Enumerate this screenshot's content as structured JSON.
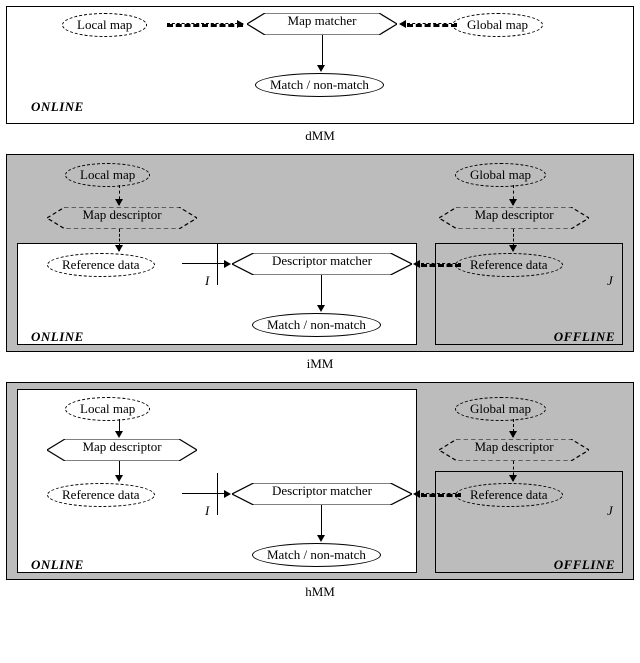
{
  "labels": {
    "local_map": "Local map",
    "global_map": "Global map",
    "map_matcher": "Map matcher",
    "match_nonmatch": "Match / non-match",
    "map_descriptor": "Map descriptor",
    "reference_data": "Reference data",
    "descriptor_matcher": "Descriptor matcher",
    "online": "ONLINE",
    "offline": "OFFLINE",
    "index_I": "I",
    "index_J": "J"
  },
  "captions": {
    "dMM": "dMM",
    "iMM": "iMM",
    "hMM": "hMM"
  },
  "chart_data": {
    "type": "flow-diagram",
    "panels": [
      {
        "id": "dMM",
        "background": "white",
        "tags": [
          "ONLINE"
        ],
        "nodes": [
          {
            "id": "local_map",
            "kind": "data",
            "label": "Local map"
          },
          {
            "id": "global_map",
            "kind": "data",
            "label": "Global map"
          },
          {
            "id": "map_matcher",
            "kind": "process",
            "label": "Map matcher"
          },
          {
            "id": "match",
            "kind": "data",
            "label": "Match / non-match"
          }
        ],
        "edges": [
          {
            "from": "local_map",
            "to": "map_matcher",
            "style": "dashed"
          },
          {
            "from": "global_map",
            "to": "map_matcher",
            "style": "dashed"
          },
          {
            "from": "map_matcher",
            "to": "match",
            "style": "solid"
          }
        ]
      },
      {
        "id": "iMM",
        "background": "grey",
        "tags": [
          "ONLINE",
          "OFFLINE"
        ],
        "nodes": [
          {
            "id": "local_map",
            "kind": "data",
            "label": "Local map",
            "region": "grey"
          },
          {
            "id": "global_map",
            "kind": "data",
            "label": "Global map",
            "region": "grey"
          },
          {
            "id": "desc_l",
            "kind": "process",
            "label": "Map descriptor",
            "region": "grey"
          },
          {
            "id": "desc_r",
            "kind": "process",
            "label": "Map descriptor",
            "region": "grey"
          },
          {
            "id": "ref_l",
            "kind": "data",
            "label": "Reference data",
            "index": "I",
            "region": "white"
          },
          {
            "id": "ref_r",
            "kind": "data",
            "label": "Reference data",
            "index": "J",
            "region": "grey-inner"
          },
          {
            "id": "dm",
            "kind": "process",
            "label": "Descriptor matcher",
            "region": "white"
          },
          {
            "id": "match",
            "kind": "data",
            "label": "Match / non-match",
            "region": "white"
          }
        ],
        "edges": [
          {
            "from": "local_map",
            "to": "desc_l",
            "style": "dashed"
          },
          {
            "from": "global_map",
            "to": "desc_r",
            "style": "dashed"
          },
          {
            "from": "desc_l",
            "to": "ref_l",
            "style": "dashed"
          },
          {
            "from": "desc_r",
            "to": "ref_r",
            "style": "dashed"
          },
          {
            "from": "ref_l",
            "to": "dm",
            "style": "solid"
          },
          {
            "from": "ref_r",
            "to": "dm",
            "style": "dashed"
          },
          {
            "from": "dm",
            "to": "match",
            "style": "solid"
          }
        ]
      },
      {
        "id": "hMM",
        "background": "grey",
        "tags": [
          "ONLINE",
          "OFFLINE"
        ],
        "note": "Same structure as iMM; left column (Local map → Map descriptor) is inside the white ONLINE region.",
        "nodes": [
          {
            "id": "local_map",
            "kind": "data",
            "label": "Local map",
            "region": "white"
          },
          {
            "id": "global_map",
            "kind": "data",
            "label": "Global map",
            "region": "grey"
          },
          {
            "id": "desc_l",
            "kind": "process",
            "label": "Map descriptor",
            "region": "white"
          },
          {
            "id": "desc_r",
            "kind": "process",
            "label": "Map descriptor",
            "region": "grey"
          },
          {
            "id": "ref_l",
            "kind": "data",
            "label": "Reference data",
            "index": "I",
            "region": "white"
          },
          {
            "id": "ref_r",
            "kind": "data",
            "label": "Reference data",
            "index": "J",
            "region": "grey-inner"
          },
          {
            "id": "dm",
            "kind": "process",
            "label": "Descriptor matcher",
            "region": "white"
          },
          {
            "id": "match",
            "kind": "data",
            "label": "Match / non-match",
            "region": "white"
          }
        ],
        "edges": [
          {
            "from": "local_map",
            "to": "desc_l",
            "style": "solid"
          },
          {
            "from": "global_map",
            "to": "desc_r",
            "style": "dashed"
          },
          {
            "from": "desc_l",
            "to": "ref_l",
            "style": "solid"
          },
          {
            "from": "desc_r",
            "to": "ref_r",
            "style": "dashed"
          },
          {
            "from": "ref_l",
            "to": "dm",
            "style": "solid"
          },
          {
            "from": "ref_r",
            "to": "dm",
            "style": "dashed"
          },
          {
            "from": "dm",
            "to": "match",
            "style": "solid"
          }
        ]
      }
    ]
  }
}
